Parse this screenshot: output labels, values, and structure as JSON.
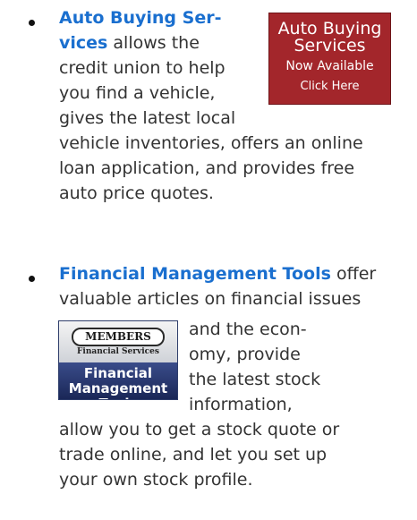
{
  "item1": {
    "link_text": "Auto Buying Ser-",
    "link_text_cont": "vices",
    "lines": [
      " allows the",
      "credit union to help",
      "you find a vehicle,",
      "gives the latest local",
      "vehicle inventories, offers an online",
      "loan application, and provides free",
      "auto price quotes."
    ],
    "banner": {
      "line1": "Auto Buying",
      "line2": "Services",
      "line3": "Now Available",
      "line4": "Click Here",
      "bg_color": "#a3262b"
    }
  },
  "item2": {
    "link_text": "Financial Management Tools",
    "lines": [
      " offer",
      "valuable articles on financial issues",
      "and the econ-",
      "omy, provide",
      "the latest stock",
      "information,",
      "allow you to get a stock quote or",
      "trade online, and let you set up",
      "your own stock profile."
    ],
    "banner": {
      "members": "MEMBERS",
      "subtitle": "Financial Services",
      "line1": "Financial",
      "line2": "Management Tools",
      "bottom_color": "#1f2d63"
    }
  },
  "colors": {
    "link": "#1a6fcf",
    "text": "#333333"
  }
}
